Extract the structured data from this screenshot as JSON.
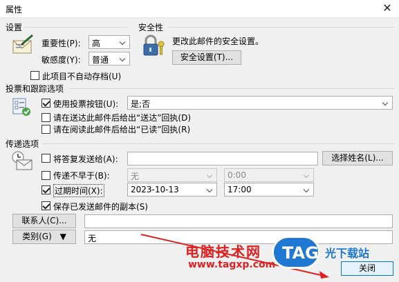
{
  "window": {
    "title": "属性"
  },
  "settings": {
    "section_title": "设置",
    "importance_label": "重要性(P):",
    "importance_value": "高",
    "sensitivity_label": "敏感度(Y):",
    "sensitivity_value": "普通",
    "no_autoarchive_label": "此项目不自动存档(U)"
  },
  "security": {
    "section_title": "安全性",
    "description": "更改此邮件的安全设置。",
    "settings_button": "安全设置(T)..."
  },
  "voting": {
    "section_title": "投票和跟踪选项",
    "use_voting_label": "使用投票按钮(U):",
    "voting_value": "是;否",
    "delivery_receipt_label": "请在送达此邮件后给出“送达”回执(D)",
    "read_receipt_label": "请在阅读此邮件后给出“已读”回执(R)"
  },
  "delivery": {
    "section_title": "传递选项",
    "reply_to_label": "将答复发送给(A):",
    "reply_to_value": "",
    "select_names_button": "选择姓名(L)...",
    "do_not_deliver_label": "传递不早于(B):",
    "do_not_deliver_date": "无",
    "do_not_deliver_time": "0:00",
    "expires_label": "过期时间(X):",
    "expires_date": "2023-10-13",
    "expires_time": "17:00",
    "save_copy_label": "保存已发送邮件的副本(S)"
  },
  "contacts": {
    "button": "联系人(C)...",
    "value": ""
  },
  "categories": {
    "button": "类别(G)",
    "value": "无"
  },
  "footer": {
    "close_button": "关闭"
  },
  "watermark": {
    "text_cn": "电脑技术网",
    "url": "www.tagxp.com",
    "logo": "TAG",
    "site": "光下载站"
  },
  "checkbox_states": {
    "no_autoarchive": false,
    "use_voting": true,
    "delivery_receipt": false,
    "read_receipt": false,
    "reply_to": false,
    "do_not_deliver": false,
    "expires": true,
    "save_copy": true
  }
}
